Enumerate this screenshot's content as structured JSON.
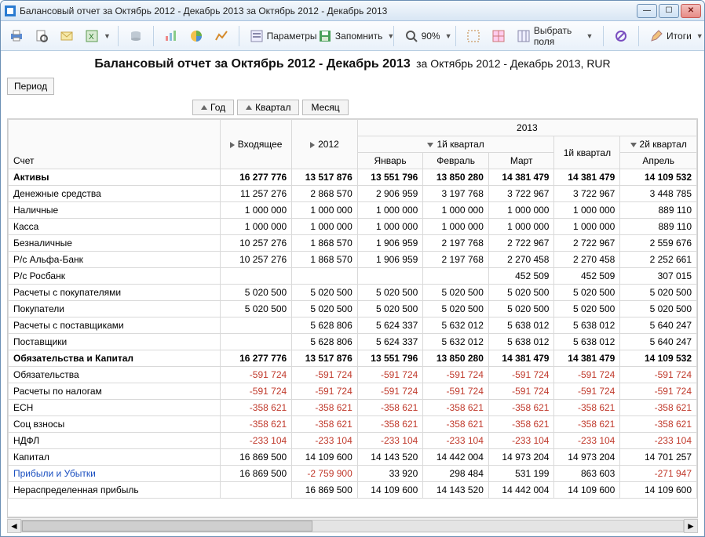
{
  "window": {
    "title": "Балансовый отчет за Октябрь 2012 - Декабрь 2013 за Октябрь 2012 - Декабрь 2013"
  },
  "toolbar": {
    "params": "Параметры",
    "remember": "Запомнить",
    "zoom": "90%",
    "select_fields": "Выбрать поля",
    "totals": "Итоги"
  },
  "subheader": {
    "title": "Балансовый отчет за Октябрь 2012 - Декабрь 2013",
    "subtitle": "за Октябрь 2012 - Декабрь 2013, RUR"
  },
  "period_btn": "Период",
  "dim": {
    "year": "Год",
    "quarter": "Квартал",
    "month": "Месяц"
  },
  "account_hdr": "Счет",
  "cols": {
    "incoming": "Входящее",
    "y2012": "2012",
    "y2013": "2013",
    "q1": "1й квартал",
    "q1b": "1й квартал",
    "q2": "2й квартал",
    "jan": "Январь",
    "feb": "Февраль",
    "mar": "Март",
    "apr": "Апрель"
  },
  "rows": [
    {
      "id": "assets",
      "label": "Активы",
      "indent": 0,
      "bold": true,
      "values": [
        "16 277 776",
        "13 517 876",
        "13 551 796",
        "13 850 280",
        "14 381 479",
        "14 381 479",
        "14 109 532"
      ]
    },
    {
      "id": "cash",
      "label": "Денежные средства",
      "indent": 1,
      "values": [
        "11 257 276",
        "2 868 570",
        "2 906 959",
        "3 197 768",
        "3 722 967",
        "3 722 967",
        "3 448 785"
      ]
    },
    {
      "id": "cash_hand",
      "label": "Наличные",
      "indent": 2,
      "values": [
        "1 000 000",
        "1 000 000",
        "1 000 000",
        "1 000 000",
        "1 000 000",
        "1 000 000",
        "889 110"
      ]
    },
    {
      "id": "till",
      "label": "Касса",
      "indent": 3,
      "values": [
        "1 000 000",
        "1 000 000",
        "1 000 000",
        "1 000 000",
        "1 000 000",
        "1 000 000",
        "889 110"
      ]
    },
    {
      "id": "noncash",
      "label": "Безналичные",
      "indent": 2,
      "values": [
        "10 257 276",
        "1 868 570",
        "1 906 959",
        "2 197 768",
        "2 722 967",
        "2 722 967",
        "2 559 676"
      ]
    },
    {
      "id": "alfa",
      "label": "Р/с Альфа-Банк",
      "indent": 3,
      "values": [
        "10 257 276",
        "1 868 570",
        "1 906 959",
        "2 197 768",
        "2 270 458",
        "2 270 458",
        "2 252 661"
      ]
    },
    {
      "id": "ros",
      "label": "Р/с Росбанк",
      "indent": 3,
      "values": [
        "",
        "",
        "",
        "",
        "452 509",
        "452 509",
        "307 015"
      ]
    },
    {
      "id": "ar",
      "label": "Расчеты с покупателями",
      "indent": 1,
      "values": [
        "5 020 500",
        "5 020 500",
        "5 020 500",
        "5 020 500",
        "5 020 500",
        "5 020 500",
        "5 020 500"
      ]
    },
    {
      "id": "buyers",
      "label": "Покупатели",
      "indent": 2,
      "values": [
        "5 020 500",
        "5 020 500",
        "5 020 500",
        "5 020 500",
        "5 020 500",
        "5 020 500",
        "5 020 500"
      ]
    },
    {
      "id": "ap",
      "label": "Расчеты с поставщиками",
      "indent": 1,
      "values": [
        "",
        "5 628 806",
        "5 624 337",
        "5 632 012",
        "5 638 012",
        "5 638 012",
        "5 640 247"
      ]
    },
    {
      "id": "suppliers",
      "label": "Поставщики",
      "indent": 2,
      "values": [
        "",
        "5 628 806",
        "5 624 337",
        "5 632 012",
        "5 638 012",
        "5 638 012",
        "5 640 247"
      ]
    },
    {
      "id": "liabcap",
      "label": "Обязательства и Капитал",
      "indent": 0,
      "bold": true,
      "values": [
        "16 277 776",
        "13 517 876",
        "13 551 796",
        "13 850 280",
        "14 381 479",
        "14 381 479",
        "14 109 532"
      ]
    },
    {
      "id": "liab",
      "label": "Обязательства",
      "indent": 1,
      "neg": true,
      "values": [
        "-591 724",
        "-591 724",
        "-591 724",
        "-591 724",
        "-591 724",
        "-591 724",
        "-591 724"
      ]
    },
    {
      "id": "tax",
      "label": "Расчеты по налогам",
      "indent": 2,
      "neg": true,
      "values": [
        "-591 724",
        "-591 724",
        "-591 724",
        "-591 724",
        "-591 724",
        "-591 724",
        "-591 724"
      ]
    },
    {
      "id": "esn",
      "label": "ЕСН",
      "indent": 3,
      "neg": true,
      "values": [
        "-358 621",
        "-358 621",
        "-358 621",
        "-358 621",
        "-358 621",
        "-358 621",
        "-358 621"
      ]
    },
    {
      "id": "soc",
      "label": "Соц взносы",
      "indent": 4,
      "neg": true,
      "values": [
        "-358 621",
        "-358 621",
        "-358 621",
        "-358 621",
        "-358 621",
        "-358 621",
        "-358 621"
      ]
    },
    {
      "id": "ndfl",
      "label": "НДФЛ",
      "indent": 3,
      "neg": true,
      "values": [
        "-233 104",
        "-233 104",
        "-233 104",
        "-233 104",
        "-233 104",
        "-233 104",
        "-233 104"
      ]
    },
    {
      "id": "capital",
      "label": "Капитал",
      "indent": 1,
      "values": [
        "16 869 500",
        "14 109 600",
        "14 143 520",
        "14 442 004",
        "14 973 204",
        "14 973 204",
        "14 701 257"
      ]
    },
    {
      "id": "pl",
      "label": "Прибыли и Убытки",
      "indent": 2,
      "link": true,
      "neg_idx": [
        1,
        6
      ],
      "values": [
        "16 869 500",
        "-2 759 900",
        "33 920",
        "298 484",
        "531 199",
        "863 603",
        "-271 947"
      ]
    },
    {
      "id": "retained",
      "label": "Нераспределенная прибыль",
      "indent": 2,
      "values": [
        "",
        "16 869 500",
        "14 109 600",
        "14 143 520",
        "14 442 004",
        "14 109 600",
        "14 109 600"
      ]
    }
  ]
}
